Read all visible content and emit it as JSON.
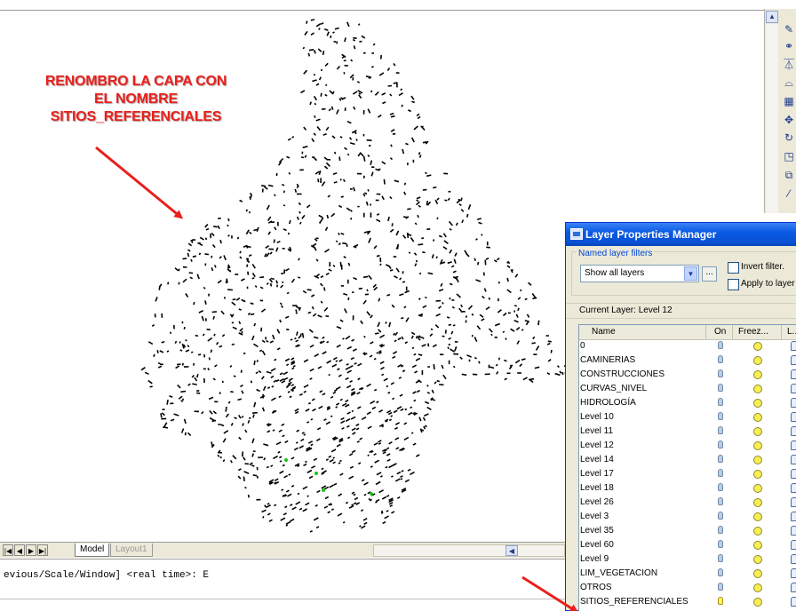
{
  "annotation": {
    "lines": [
      "RENOMBRO LA CAPA CON",
      "EL NOMBRE",
      "SITIOS_REFERENCIALES"
    ],
    "color": "#e8201c"
  },
  "tabs": {
    "model": "Model",
    "layout": "Layout1",
    "nav_icons": [
      "first-tab-icon",
      "prev-tab-icon",
      "next-tab-icon",
      "last-tab-icon"
    ]
  },
  "command_line": {
    "text": "evious/Scale/Window] <real time>: E"
  },
  "toolbar": {
    "icons": [
      "pencil-icon",
      "copy-icon",
      "mirror-icon",
      "offset-icon",
      "array-icon",
      "move-icon",
      "rotate-icon",
      "scale-icon",
      "stretch-icon",
      "trim-icon"
    ]
  },
  "layer_dialog": {
    "title": "Layer Properties Manager",
    "filters_label": "Named layer filters",
    "filter_value": "Show all layers",
    "invert_filter": "Invert filter.",
    "apply_to_layers": "Apply to layer",
    "current_layer": "Current Layer:  Level 12",
    "columns": [
      "Name",
      "On",
      "Freez...",
      "L..."
    ],
    "layers": [
      {
        "name": "0",
        "on": false
      },
      {
        "name": "CAMINERIAS",
        "on": false
      },
      {
        "name": "CONSTRUCCIONES",
        "on": false
      },
      {
        "name": "CURVAS_NIVEL",
        "on": false
      },
      {
        "name": "HIDROLOGÍA",
        "on": false
      },
      {
        "name": "Level 10",
        "on": false
      },
      {
        "name": "Level 11",
        "on": false
      },
      {
        "name": "Level 12",
        "on": false
      },
      {
        "name": "Level 14",
        "on": false
      },
      {
        "name": "Level 17",
        "on": false
      },
      {
        "name": "Level 18",
        "on": false
      },
      {
        "name": "Level 26",
        "on": false
      },
      {
        "name": "Level 3",
        "on": false
      },
      {
        "name": "Level 35",
        "on": false
      },
      {
        "name": "Level 60",
        "on": false
      },
      {
        "name": "Level 9",
        "on": false
      },
      {
        "name": "LIM_VEGETACION",
        "on": false
      },
      {
        "name": "OTROS",
        "on": false
      },
      {
        "name": "SITIOS_REFERENCIALES",
        "on": true
      }
    ]
  }
}
